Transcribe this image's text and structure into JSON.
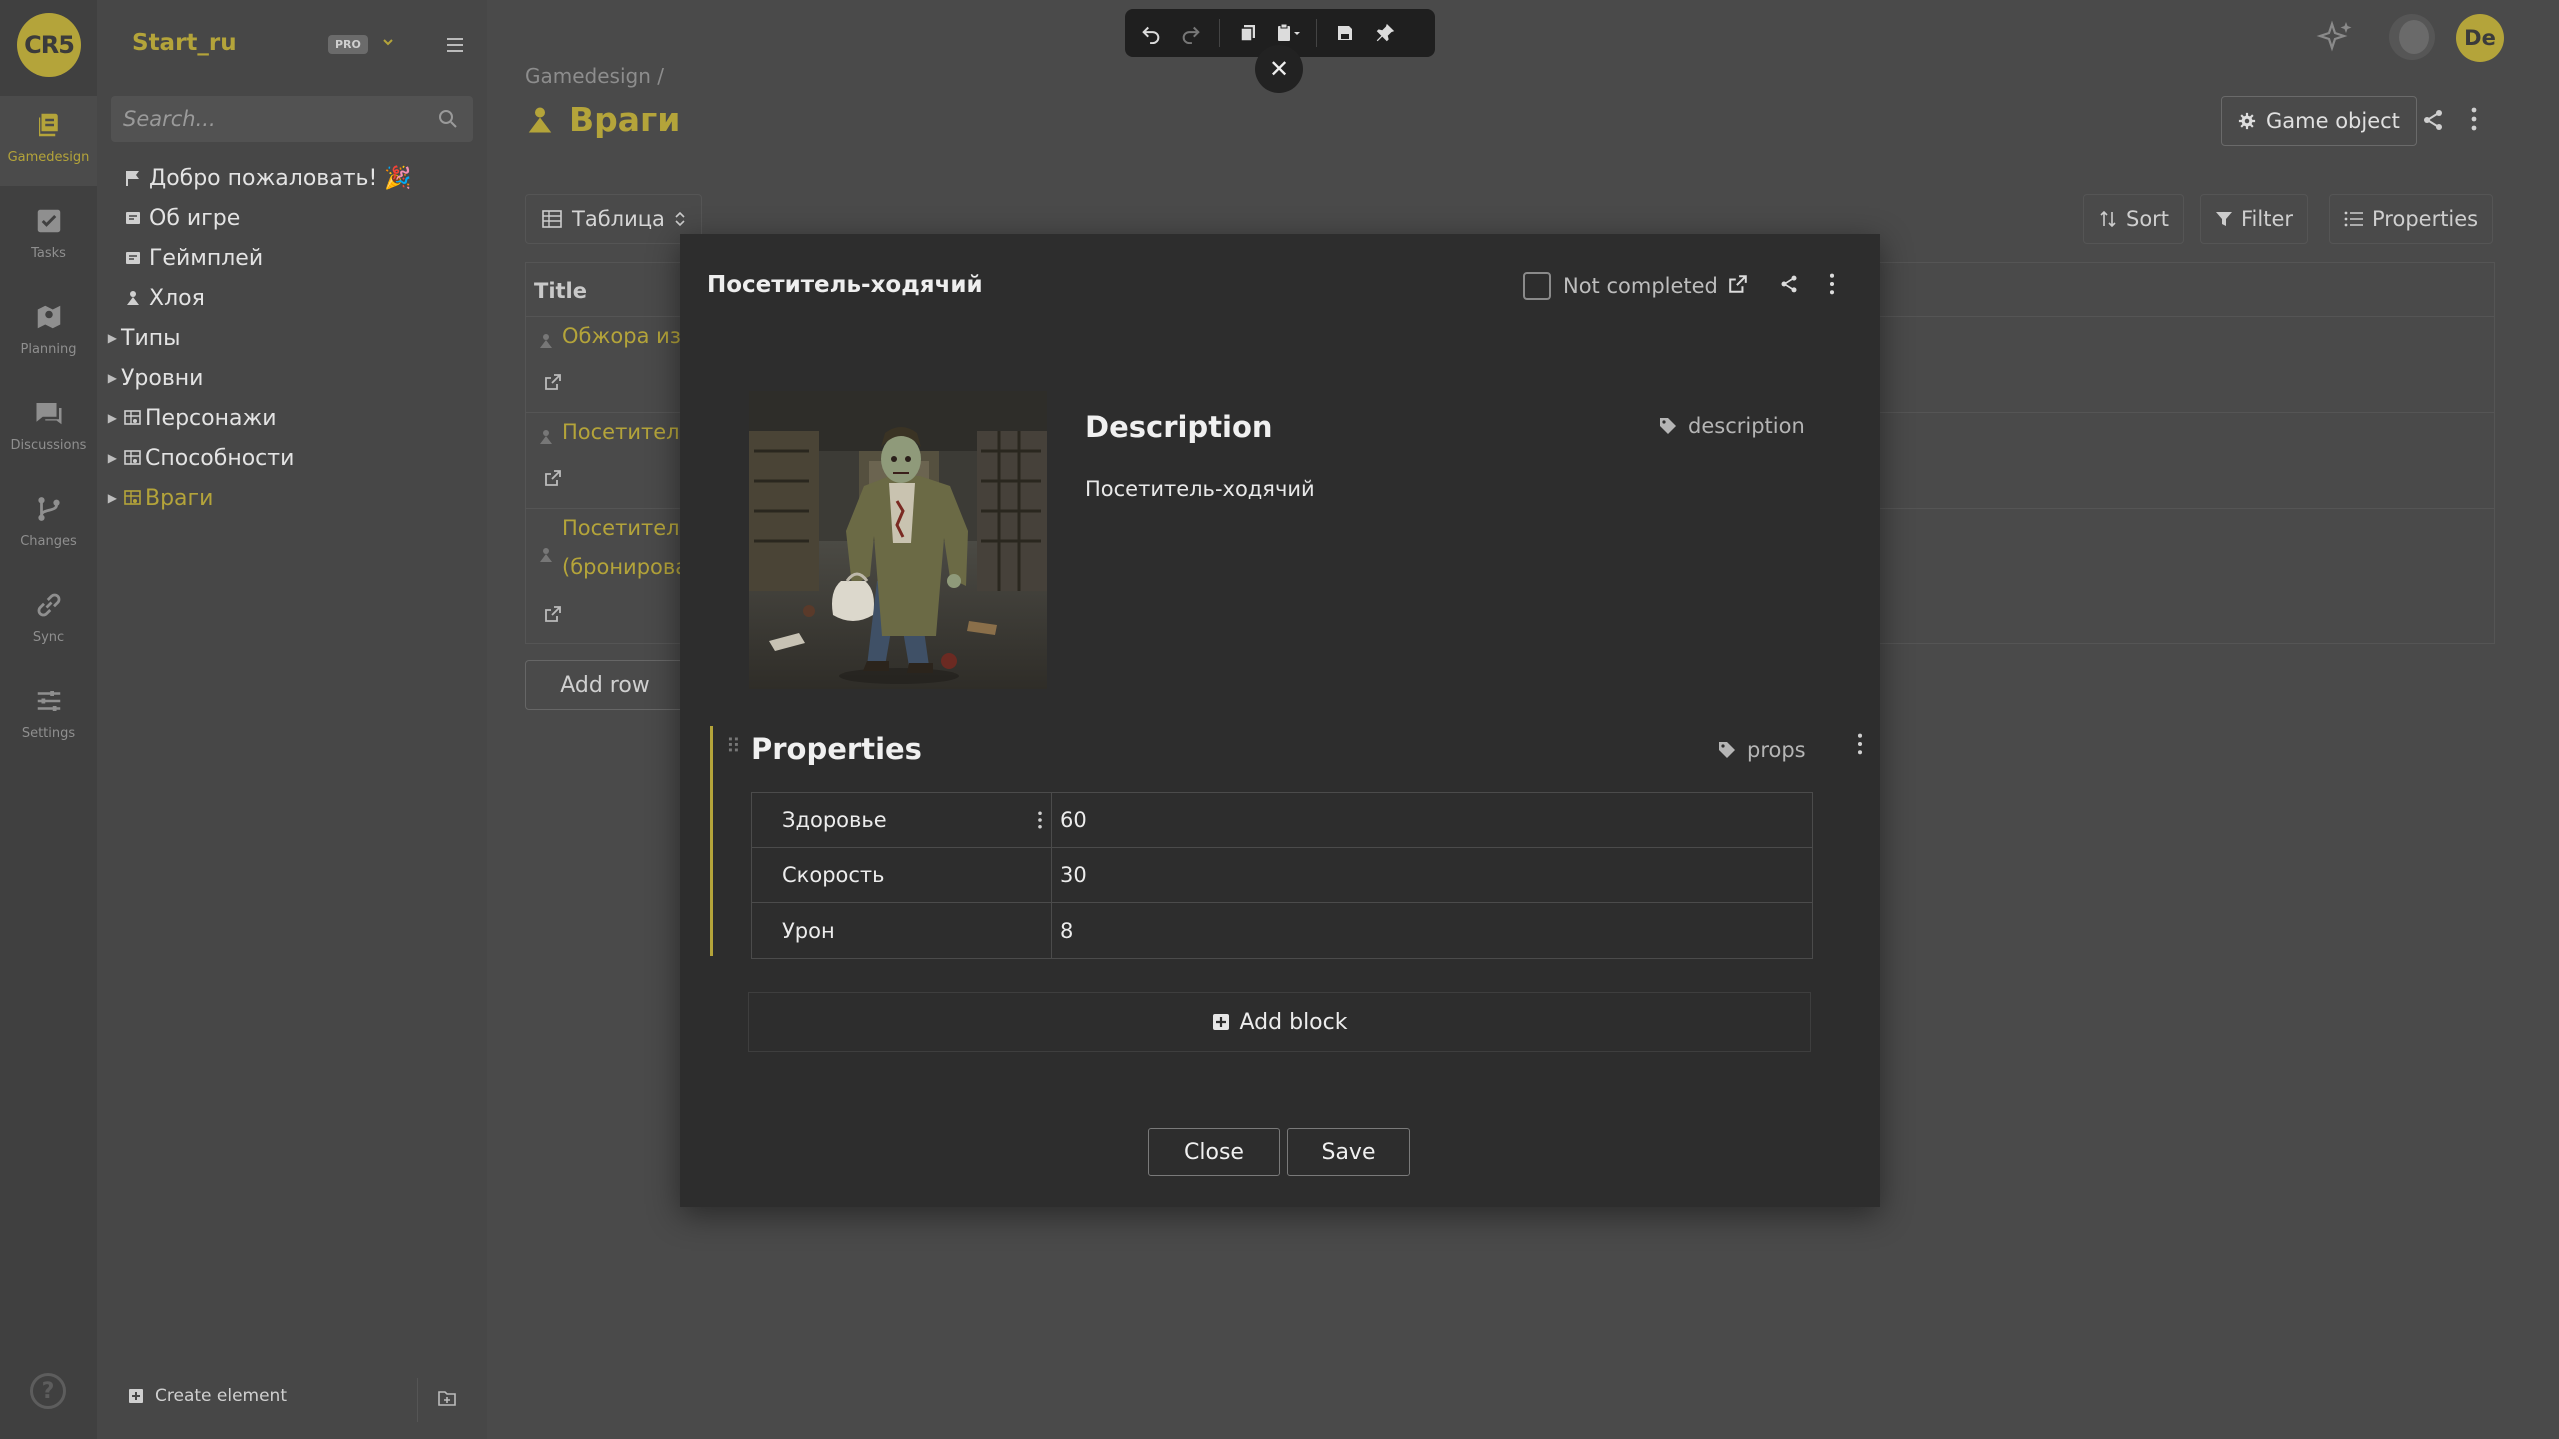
{
  "rail": {
    "logo": "CR5",
    "items": [
      {
        "label": "Gamedesign",
        "icon": "gamedesign-icon"
      },
      {
        "label": "Tasks",
        "icon": "tasks-icon"
      },
      {
        "label": "Planning",
        "icon": "planning-icon"
      },
      {
        "label": "Discussions",
        "icon": "discussions-icon"
      },
      {
        "label": "Changes",
        "icon": "changes-icon"
      },
      {
        "label": "Sync",
        "icon": "sync-icon"
      },
      {
        "label": "Settings",
        "icon": "settings-icon"
      }
    ],
    "help": "?"
  },
  "tree": {
    "project_name": "Start_ru",
    "badge": "PRO",
    "search_placeholder": "Search...",
    "items": [
      {
        "label": "Добро пожаловать! 🎉",
        "icon": "flag-icon"
      },
      {
        "label": "Об игре",
        "icon": "doc-icon"
      },
      {
        "label": "Геймплей",
        "icon": "doc-icon"
      },
      {
        "label": "Хлоя",
        "icon": "character-icon"
      },
      {
        "label": "Типы",
        "icon": ""
      },
      {
        "label": "Уровни",
        "icon": ""
      },
      {
        "label": "Персонажи",
        "icon": "table-icon"
      },
      {
        "label": "Способности",
        "icon": "table-icon"
      },
      {
        "label": "Враги",
        "icon": "table-icon"
      }
    ],
    "footer": {
      "create_label": "Create element"
    }
  },
  "toolbar": {
    "buttons": [
      "undo-icon",
      "redo-icon",
      "copy-icon",
      "paste-icon",
      "save-icon",
      "pin-icon"
    ],
    "close": "✕"
  },
  "page": {
    "breadcrumb": "Gamedesign /",
    "title": "Враги",
    "game_object_label": "Game object",
    "view_label": "Таблица",
    "sort_label": "Sort",
    "filter_label": "Filter",
    "properties_label": "Properties",
    "table_header": "Title",
    "rows": [
      {
        "lines": [
          "Обжора из"
        ]
      },
      {
        "lines": [
          "Посетитель"
        ]
      },
      {
        "lines": [
          "Посетитель",
          "(бронирова"
        ]
      }
    ],
    "add_row_label": "Add row"
  },
  "user": {
    "initials": "De"
  },
  "modal": {
    "title": "Посетитель-ходячий",
    "status_label": "Not completed",
    "description_heading": "Description",
    "description_tag": "description",
    "description_text": "Посетитель-ходячий",
    "properties_heading": "Properties",
    "properties_tag": "props",
    "properties": [
      {
        "key": "Здоровье",
        "value": "60"
      },
      {
        "key": "Скорость",
        "value": "30"
      },
      {
        "key": "Урон",
        "value": "8"
      }
    ],
    "add_block_label": "Add block",
    "close_label": "Close",
    "save_label": "Save"
  },
  "colors": {
    "accent": "#b4a43a",
    "modal_bg": "#2d2d2d",
    "page_bg": "#4a4a4a"
  }
}
